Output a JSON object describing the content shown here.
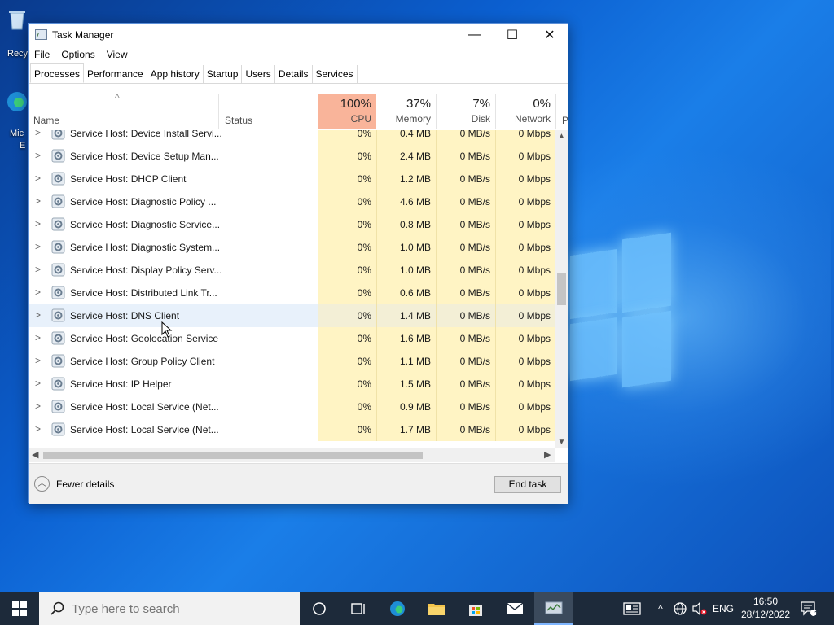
{
  "desktop": {
    "recycle_label": "Recy",
    "edge_label_1": "Mic",
    "edge_label_2": "E"
  },
  "window": {
    "title": "Task Manager",
    "minimize": "—",
    "maximize": "☐",
    "close": "✕"
  },
  "menu": [
    "File",
    "Options",
    "View"
  ],
  "tabs": [
    "Processes",
    "Performance",
    "App history",
    "Startup",
    "Users",
    "Details",
    "Services"
  ],
  "columns": {
    "name": "Name",
    "status": "Status",
    "cpu_pct": "100%",
    "cpu": "CPU",
    "mem_pct": "37%",
    "mem": "Memory",
    "disk_pct": "7%",
    "disk": "Disk",
    "net_pct": "0%",
    "net": "Network",
    "next": "P"
  },
  "rows": [
    {
      "name": "Service Host: Device Install Servi...",
      "cpu": "0%",
      "mem": "0.4 MB",
      "disk": "0 MB/s",
      "net": "0 Mbps"
    },
    {
      "name": "Service Host: Device Setup Man...",
      "cpu": "0%",
      "mem": "2.4 MB",
      "disk": "0 MB/s",
      "net": "0 Mbps"
    },
    {
      "name": "Service Host: DHCP Client",
      "cpu": "0%",
      "mem": "1.2 MB",
      "disk": "0 MB/s",
      "net": "0 Mbps"
    },
    {
      "name": "Service Host: Diagnostic Policy ...",
      "cpu": "0%",
      "mem": "4.6 MB",
      "disk": "0 MB/s",
      "net": "0 Mbps"
    },
    {
      "name": "Service Host: Diagnostic Service...",
      "cpu": "0%",
      "mem": "0.8 MB",
      "disk": "0 MB/s",
      "net": "0 Mbps"
    },
    {
      "name": "Service Host: Diagnostic System...",
      "cpu": "0%",
      "mem": "1.0 MB",
      "disk": "0 MB/s",
      "net": "0 Mbps"
    },
    {
      "name": "Service Host: Display Policy Serv...",
      "cpu": "0%",
      "mem": "1.0 MB",
      "disk": "0 MB/s",
      "net": "0 Mbps"
    },
    {
      "name": "Service Host: Distributed Link Tr...",
      "cpu": "0%",
      "mem": "0.6 MB",
      "disk": "0 MB/s",
      "net": "0 Mbps"
    },
    {
      "name": "Service Host: DNS Client",
      "cpu": "0%",
      "mem": "1.4 MB",
      "disk": "0 MB/s",
      "net": "0 Mbps"
    },
    {
      "name": "Service Host: Geolocation Service",
      "cpu": "0%",
      "mem": "1.6 MB",
      "disk": "0 MB/s",
      "net": "0 Mbps"
    },
    {
      "name": "Service Host: Group Policy Client",
      "cpu": "0%",
      "mem": "1.1 MB",
      "disk": "0 MB/s",
      "net": "0 Mbps"
    },
    {
      "name": "Service Host: IP Helper",
      "cpu": "0%",
      "mem": "1.5 MB",
      "disk": "0 MB/s",
      "net": "0 Mbps"
    },
    {
      "name": "Service Host: Local Service (Net...",
      "cpu": "0%",
      "mem": "0.9 MB",
      "disk": "0 MB/s",
      "net": "0 Mbps"
    },
    {
      "name": "Service Host: Local Service (Net...",
      "cpu": "0%",
      "mem": "1.7 MB",
      "disk": "0 MB/s",
      "net": "0 Mbps"
    }
  ],
  "highlighted_row": 8,
  "footer": {
    "fewer_details": "Fewer details",
    "end_task": "End task"
  },
  "taskbar": {
    "search_placeholder": "Type here to search",
    "language": "ENG",
    "time": "16:50",
    "date": "28/12/2022",
    "notification_count": "1"
  },
  "colors": {
    "cpu_header": "#f9b49a",
    "metric_cell": "#fff4c4",
    "taskbar": "#1d2a3a",
    "accent": "#0078d7"
  }
}
